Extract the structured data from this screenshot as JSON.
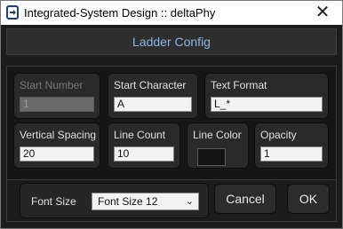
{
  "window": {
    "title": "Integrated-System Design :: deltaPhy",
    "close_glyph": "✕"
  },
  "dialog": {
    "header": "Ladder Config"
  },
  "fields": {
    "start_number": {
      "label": "Start Number",
      "value": "1",
      "enabled": false
    },
    "start_character": {
      "label": "Start Character",
      "value": "A"
    },
    "text_format": {
      "label": "Text Format",
      "value": "L_*"
    },
    "vertical_spacing": {
      "label": "Vertical Spacing",
      "value": "20"
    },
    "line_count": {
      "label": "Line Count",
      "value": "10"
    },
    "line_color": {
      "label": "Line Color",
      "color": "#141414"
    },
    "opacity": {
      "label": "Opacity",
      "value": "1"
    }
  },
  "font": {
    "label": "Font Size",
    "selected": "Font Size 12"
  },
  "buttons": {
    "cancel": "Cancel",
    "ok": "OK"
  },
  "colors": {
    "accent": "#8ab4e8",
    "background": "#1c1c1c"
  }
}
